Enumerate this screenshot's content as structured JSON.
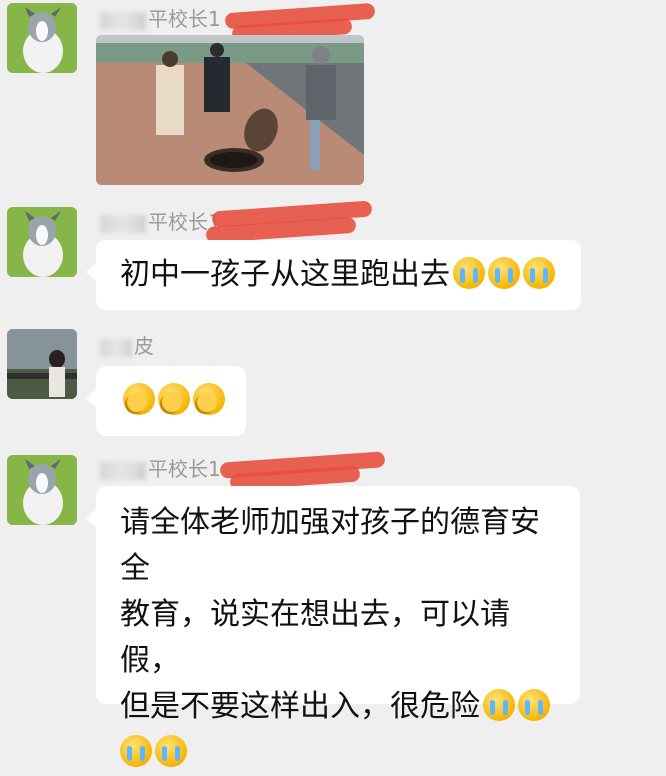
{
  "messages": [
    {
      "sender_partial": "平校长1",
      "type": "image"
    },
    {
      "sender_partial": "平校长1",
      "type": "text",
      "text": "初中一孩子从这里跑出去",
      "emoji_count": 3,
      "emoji": "crying-face"
    },
    {
      "sender_partial": "皮",
      "type": "emoji",
      "emoji_count": 3,
      "emoji": "facepalm"
    },
    {
      "sender_partial": "平校长1",
      "type": "text",
      "lines": [
        "请全体老师加强对孩子的德育安全",
        "教育，说实在想出去，可以请假，",
        "但是不要这样出入，很危险"
      ],
      "emoji_count": 4,
      "emoji": "crying-face"
    }
  ],
  "colors": {
    "background": "#efefef",
    "bubble": "#ffffff",
    "redaction": "#e74c3c"
  }
}
